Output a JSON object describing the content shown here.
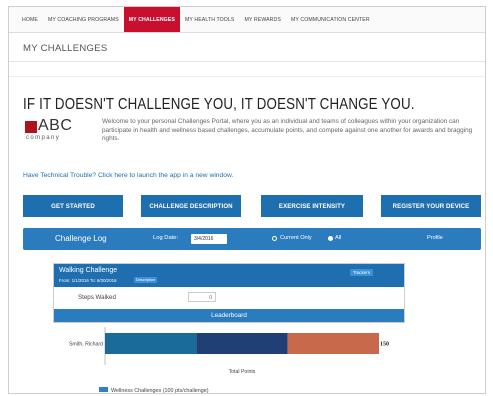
{
  "nav": {
    "items": [
      {
        "label": "HOME"
      },
      {
        "label": "MY COACHING PROGRAMS"
      },
      {
        "label": "MY CHALLENGES",
        "active": true
      },
      {
        "label": "MY HEALTH TOOLS"
      },
      {
        "label": "MY REWARDS"
      },
      {
        "label": "MY COMMUNICATION CENTER"
      }
    ],
    "active_color": "#c8102e"
  },
  "page_title": "MY CHALLENGES",
  "headline": "IF IT DOESN'T CHALLENGE YOU, IT DOESN'T CHANGE YOU.",
  "logo": {
    "text": "ABC",
    "subtext": "company",
    "color": "#b0121d"
  },
  "intro": "Welcome to your personal Challenges Portal, where you as an individual and teams of colleagues within your organization can participate in health and wellness based challenges, accumulate points, and compete against one another for awards and bragging rights.",
  "tech_link": "Have Technical Trouble? Click here to launch the app in a new window.",
  "buttons": {
    "get_started": "GET STARTED",
    "challenge_description": "CHALLENGE DESCRIPTION",
    "exercise_intensity": "EXERCISE INTENSITY",
    "register_device": "REGISTER YOUR DEVICE"
  },
  "log_bar": {
    "title": "Challenge Log",
    "date_label": "Log Date:",
    "date_value": "3/4/2016",
    "radio_current": "Current Only",
    "radio_all": "All",
    "selected": "All",
    "profile": "Profile"
  },
  "challenge": {
    "title": "Walking Challenge",
    "dates": "From: 1/1/2016 To: 6/30/2016",
    "description_tag": "Description",
    "trackers_tag": "Trackers",
    "steps_label": "Steps Walked",
    "steps_value": "0",
    "leaderboard": "Leaderboard"
  },
  "chart_data": {
    "type": "bar",
    "orientation": "horizontal",
    "stacked": true,
    "categories": [
      "Smith, Richard"
    ],
    "segments": [
      {
        "value": 50,
        "color": "#1a6a9a"
      },
      {
        "value": 50,
        "color": "#1f3f75"
      },
      {
        "value": 50,
        "color": "#c7694a"
      }
    ],
    "total_label": "150",
    "xlabel": "Total Points",
    "xlim": [
      0,
      150
    ],
    "legend": [
      {
        "name": "Wellness Challenges (100 pts/challenge)",
        "color": "#2f7fd0"
      }
    ]
  }
}
